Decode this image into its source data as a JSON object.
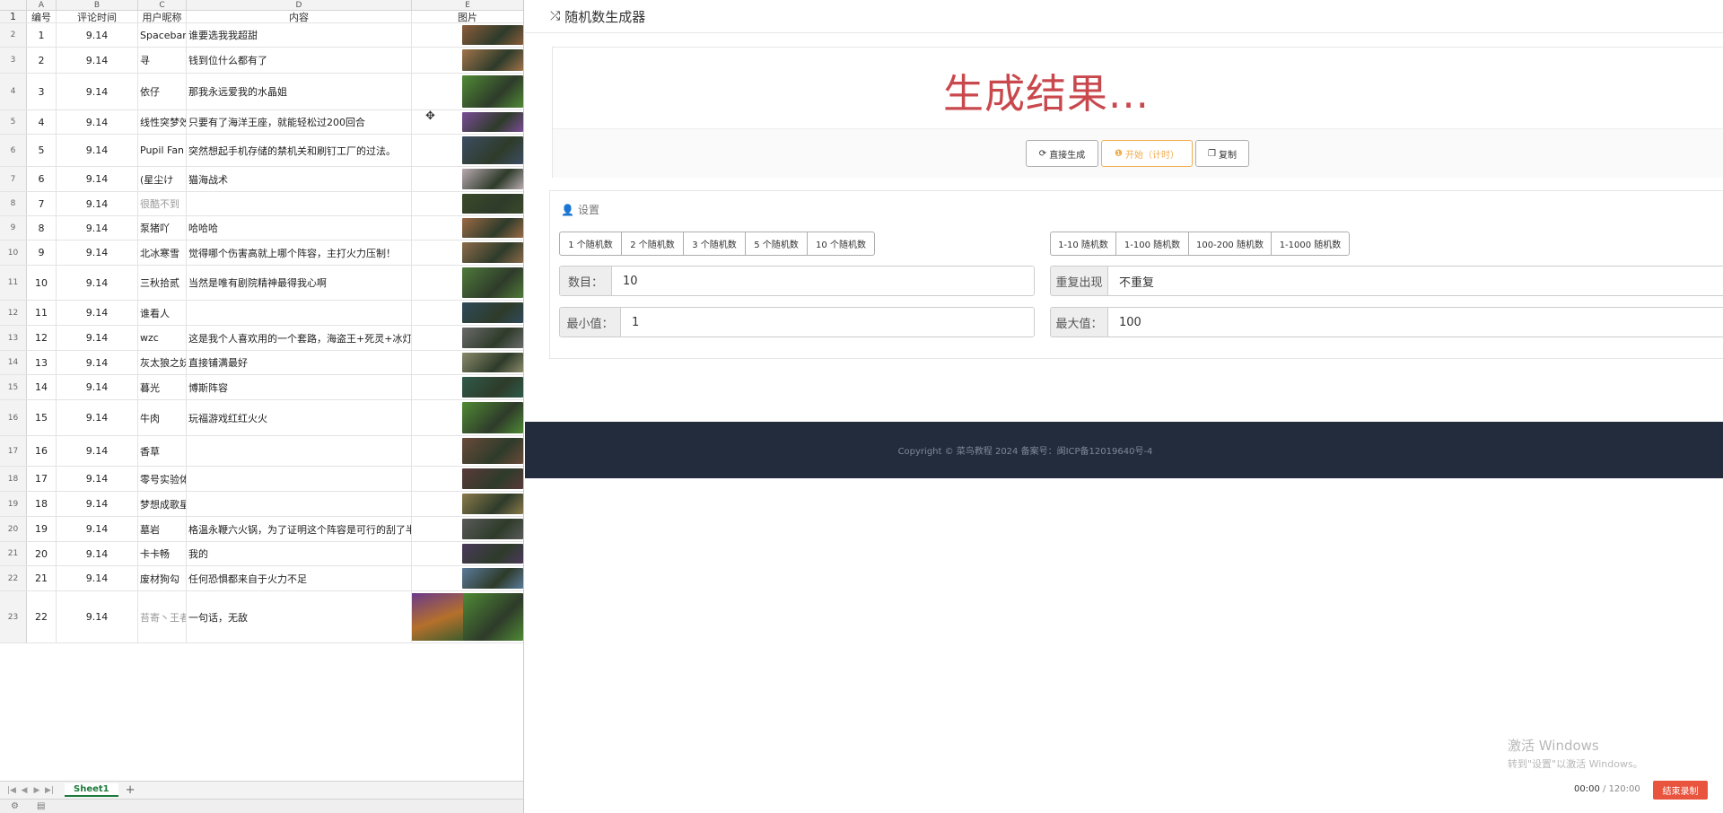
{
  "sheet": {
    "columns": [
      "",
      "A",
      "B",
      "C",
      "D",
      "E"
    ],
    "header_row": {
      "num": "1",
      "a": "编号",
      "b": "评论时间",
      "c": "用户昵称",
      "d": "内容",
      "e": "图片"
    },
    "rows": [
      {
        "num": "2",
        "a": "1",
        "b": "9.14",
        "c": "Spacebar",
        "d": "谁要选我我超甜",
        "thumb_color": "#8a5c3b"
      },
      {
        "num": "3",
        "a": "2",
        "b": "9.14",
        "c": "寻",
        "d": "钱到位什么都有了",
        "thumb_color": "#a0734a"
      },
      {
        "num": "4",
        "a": "3",
        "b": "9.14",
        "c": "依仔",
        "d": "那我永远爱我的水晶姐",
        "thumb_color": "#4f8a35"
      },
      {
        "num": "5",
        "a": "4",
        "b": "9.14",
        "c": "线性突梦效",
        "d": "只要有了海洋王座，就能轻松过200回合",
        "thumb_color": "#7a4c96"
      },
      {
        "num": "6",
        "a": "5",
        "b": "9.14",
        "c": "Pupil Fan",
        "d": "突然想起手机存储的禁机关和刷钉工厂的过法。",
        "thumb_color": "#3d4d62"
      },
      {
        "num": "7",
        "a": "6",
        "b": "9.14",
        "c": "(星尘け",
        "d": "猫海战术",
        "thumb_color": "#b8a9b0"
      },
      {
        "num": "8",
        "a": "7",
        "b": "9.14",
        "c": "很酷不到",
        "d": "",
        "thumb_color": "#3a4a2a",
        "grey": true
      },
      {
        "num": "9",
        "a": "8",
        "b": "9.14",
        "c": "泵猪吖",
        "d": "哈哈哈",
        "thumb_color": "#9a6a45"
      },
      {
        "num": "10",
        "a": "9",
        "b": "9.14",
        "c": "北冰寒雪",
        "d": "觉得哪个伤害高就上哪个阵容，主打火力压制！",
        "thumb_color": "#8b6a4a"
      },
      {
        "num": "11",
        "a": "10",
        "b": "9.14",
        "c": "三秋拾贰",
        "d": "当然是唯有剧院精神最得我心啊",
        "thumb_color": "#4f7a3a"
      },
      {
        "num": "12",
        "a": "11",
        "b": "9.14",
        "c": "谁看人",
        "d": "",
        "thumb_color": "#2f4a5a"
      },
      {
        "num": "13",
        "a": "12",
        "b": "9.14",
        "c": "wzc",
        "d": "这是我个人喜欢用的一个套路，海盗王+死灵+冰灯，…",
        "thumb_color": "#6a6a6a"
      },
      {
        "num": "14",
        "a": "13",
        "b": "9.14",
        "c": "灰太狼之妖",
        "d": "直接铺满最好",
        "thumb_color": "#8a8a6a"
      },
      {
        "num": "15",
        "a": "14",
        "b": "9.14",
        "c": "暮光",
        "d": "博斯阵容",
        "thumb_color": "#2f5a4a"
      },
      {
        "num": "16",
        "a": "15",
        "b": "9.14",
        "c": "牛肉",
        "d": "玩福游戏红红火火",
        "thumb_color": "#4f8a35"
      },
      {
        "num": "17",
        "a": "16",
        "b": "9.14",
        "c": "香草",
        "d": "",
        "thumb_color": "#6a4a3a"
      },
      {
        "num": "18",
        "a": "17",
        "b": "9.14",
        "c": "零号实验体",
        "d": "",
        "thumb_color": "#5a3a3a"
      },
      {
        "num": "19",
        "a": "18",
        "b": "9.14",
        "c": "梦想成歌星",
        "d": "",
        "thumb_color": "#8a7a4a"
      },
      {
        "num": "20",
        "a": "19",
        "b": "9.14",
        "c": "墓岩",
        "d": "格温永鞭六火锅，为了证明这个阵容是可行的刮了半个",
        "thumb_color": "#5a5a5a"
      },
      {
        "num": "21",
        "a": "20",
        "b": "9.14",
        "c": "卡卡畅",
        "d": "我的",
        "thumb_color": "#4a3a5a"
      },
      {
        "num": "22",
        "a": "21",
        "b": "9.14",
        "c": "废材狗勾",
        "d": "任何恐惧都来自于火力不足",
        "thumb_color": "#5a7a9a"
      },
      {
        "num": "23",
        "a": "22",
        "b": "9.14",
        "c": "苔寄丶王者",
        "d": "一句话，无敌",
        "thumb_color": "#4f8a35",
        "grey_c": true
      }
    ],
    "tab_label": "Sheet1",
    "add_label": "+"
  },
  "app": {
    "title": "随机数生成器",
    "result_text": "生成结果...",
    "buttons": {
      "direct": "直接生成",
      "start": "开始（计时）",
      "copy": "复制"
    },
    "settings_title": "设置",
    "count_presets": [
      "1 个随机数",
      "2 个随机数",
      "3 个随机数",
      "5 个随机数",
      "10 个随机数"
    ],
    "range_presets": [
      "1-10 随机数",
      "1-100 随机数",
      "100-200 随机数",
      "1-1000 随机数"
    ],
    "fields": {
      "count_label": "数目：",
      "count_value": "10",
      "repeat_label": "重复出现",
      "repeat_value": "不重复",
      "min_label": "最小值：",
      "min_value": "1",
      "max_label": "最大值：",
      "max_value": "100"
    },
    "footer": "Copyright © 菜鸟教程 2024 备案号：闽ICP备12019640号-4"
  },
  "overlay": {
    "watermark_line1": "激活 Windows",
    "watermark_line2": "转到\"设置\"以激活 Windows。",
    "timer_current": "00:00",
    "timer_total": "/ 120:00",
    "record_button": "结束录制"
  },
  "colors": {
    "result_red": "#c9484d",
    "warn_orange": "#f0ad4e",
    "footer_bg": "#232c3d",
    "record_red": "#e8543e",
    "sheet_tab_green": "#1e7a3c"
  }
}
